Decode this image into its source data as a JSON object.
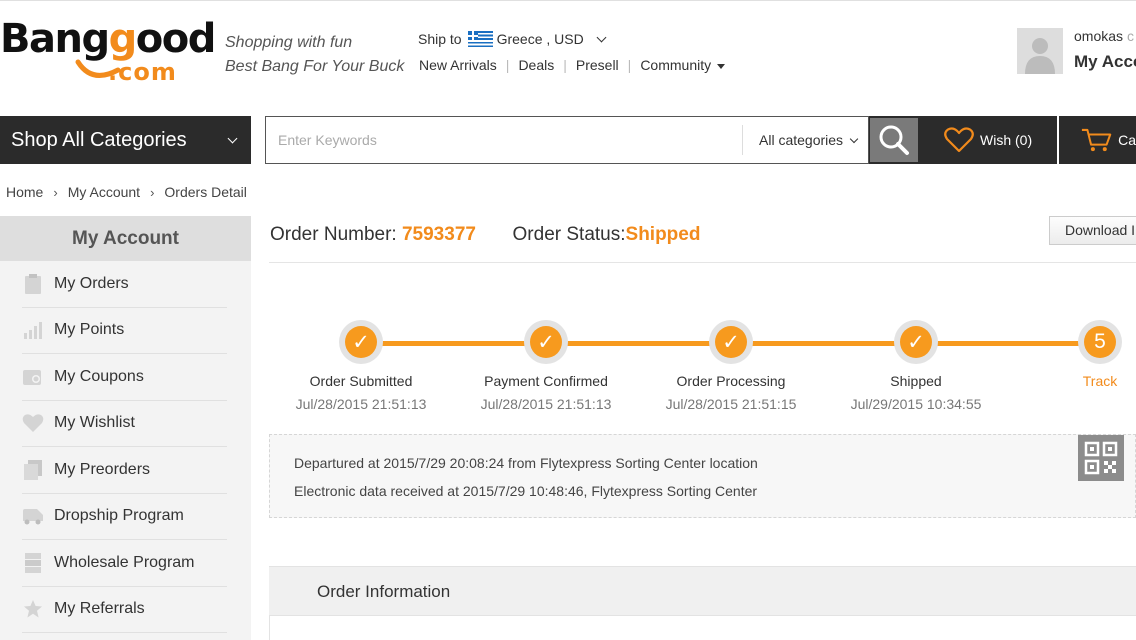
{
  "brand": {
    "logo_top": "Banggood",
    "logo_bottom": ".com",
    "slogan_line1": "Shopping with fun",
    "slogan_line2": "Best Bang For Your Buck",
    "accent_color": "#f28b1c"
  },
  "header": {
    "ship_to_label": "Ship to",
    "ship_to_value": "Greece , USD",
    "nav": [
      "New Arrivals",
      "Deals",
      "Presell",
      "Community"
    ],
    "user_name": "omokas",
    "user_suffix": "c",
    "my_account": "My Acco"
  },
  "navbar": {
    "shop_all": "Shop All Categories",
    "search_placeholder": "Enter Keywords",
    "category_select": "All categories",
    "wish_label": "Wish (0)",
    "cart_label": "Ca"
  },
  "breadcrumb": [
    "Home",
    "My Account",
    "Orders Detail"
  ],
  "sidebar": {
    "title": "My Account",
    "items": [
      {
        "label": "My Orders",
        "icon": "clipboard-icon"
      },
      {
        "label": "My Points",
        "icon": "bars-icon"
      },
      {
        "label": "My Coupons",
        "icon": "coupon-icon"
      },
      {
        "label": "My Wishlist",
        "icon": "heart-icon"
      },
      {
        "label": "My Preorders",
        "icon": "stack-icon"
      },
      {
        "label": "Dropship Program",
        "icon": "truck-icon"
      },
      {
        "label": "Wholesale Program",
        "icon": "boxes-icon"
      },
      {
        "label": "My Referrals",
        "icon": "star-icon"
      }
    ]
  },
  "order": {
    "number_label": "Order Number:",
    "number": "7593377",
    "status_label": "Order Status:",
    "status": "Shipped",
    "download_label": "Download I"
  },
  "progress": {
    "steps": [
      {
        "label": "Order Submitted",
        "time": "Jul/28/2015 21:51:13",
        "state": "done"
      },
      {
        "label": "Payment Confirmed",
        "time": "Jul/28/2015 21:51:13",
        "state": "done"
      },
      {
        "label": "Order Processing",
        "time": "Jul/28/2015 21:51:15",
        "state": "done"
      },
      {
        "label": "Shipped",
        "time": "Jul/29/2015 10:34:55",
        "state": "done"
      },
      {
        "label": "Track",
        "time": "",
        "state": "current",
        "number": "5"
      }
    ],
    "check_glyph": "✓"
  },
  "tracking": {
    "lines": [
      "Departured at 2015/7/29 20:08:24 from Flytexpress Sorting Center location",
      "Electronic data received at 2015/7/29 10:48:46, Flytexpress Sorting Center"
    ]
  },
  "order_info": {
    "title": "Order Information"
  }
}
